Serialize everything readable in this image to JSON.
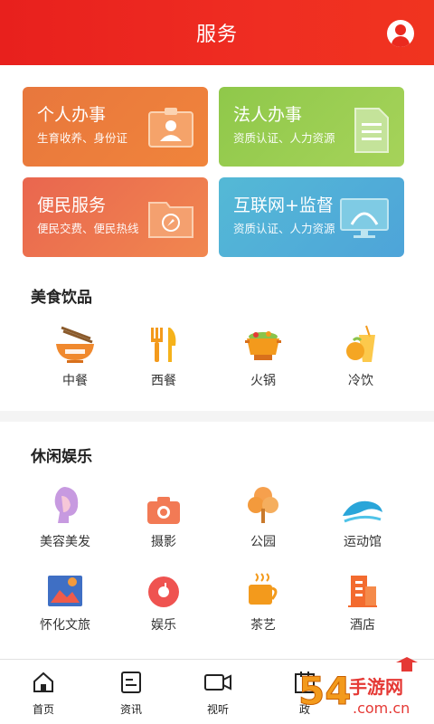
{
  "header": {
    "title": "服务",
    "avatar_icon": "user-circle-icon"
  },
  "service_cards": [
    {
      "title": "个人办事",
      "subtitle": "生育收养、身份证",
      "icon": "id-card-icon"
    },
    {
      "title": "法人办事",
      "subtitle": "资质认证、人力资源",
      "icon": "document-icon"
    },
    {
      "title": "便民服务",
      "subtitle": "便民交费、便民热线",
      "icon": "compass-folder-icon"
    },
    {
      "title": "互联网+监督",
      "subtitle": "资质认证、人力资源",
      "icon": "monitor-icon"
    }
  ],
  "food": {
    "title": "美食饮品",
    "items": [
      {
        "label": "中餐",
        "icon": "noodle-bowl-icon"
      },
      {
        "label": "西餐",
        "icon": "fork-knife-icon"
      },
      {
        "label": "火锅",
        "icon": "hotpot-icon"
      },
      {
        "label": "冷饮",
        "icon": "cold-drink-icon"
      }
    ]
  },
  "leisure": {
    "title": "休闲娱乐",
    "items": [
      {
        "label": "美容美发",
        "icon": "hair-salon-icon"
      },
      {
        "label": "摄影",
        "icon": "camera-icon"
      },
      {
        "label": "公园",
        "icon": "tree-icon"
      },
      {
        "label": "运动馆",
        "icon": "swim-wave-icon"
      },
      {
        "label": "怀化文旅",
        "icon": "map-pin-icon"
      },
      {
        "label": "娱乐",
        "icon": "music-disc-icon"
      },
      {
        "label": "茶艺",
        "icon": "tea-cup-icon"
      },
      {
        "label": "酒店",
        "icon": "hotel-building-icon"
      }
    ]
  },
  "tabbar": [
    {
      "label": "首页",
      "icon": "home-icon"
    },
    {
      "label": "资讯",
      "icon": "news-icon"
    },
    {
      "label": "视听",
      "icon": "video-icon"
    },
    {
      "label": "政",
      "icon": "government-icon"
    }
  ],
  "watermark": {
    "brand": "54手游网",
    "domain": ".com.cn"
  },
  "colors": {
    "header": "#ea2a1f",
    "card_personal": "#ed7c3c",
    "card_legal": "#9bcd50",
    "card_convenience": "#ec7450",
    "card_internet": "#50aed8"
  }
}
